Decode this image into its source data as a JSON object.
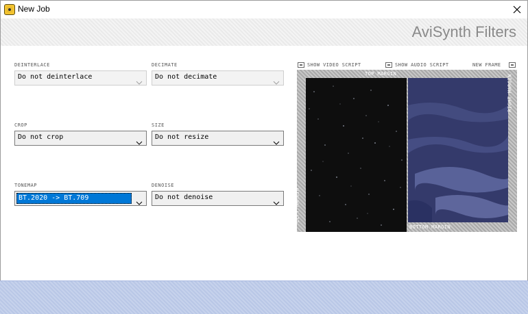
{
  "window": {
    "title": "New Job"
  },
  "header": {
    "title": "AviSynth Filters"
  },
  "filters": {
    "deinterlace": {
      "label": "DEINTERLACE",
      "value": "Do not deinterlace"
    },
    "decimate": {
      "label": "DECIMATE",
      "value": "Do not decimate"
    },
    "crop": {
      "label": "CROP",
      "value": "Do not crop"
    },
    "size": {
      "label": "SIZE",
      "value": "Do not resize"
    },
    "tonemap": {
      "label": "TONEMAP",
      "value": "BT.2020 -> BT.709"
    },
    "denoise": {
      "label": "DENOISE",
      "value": "Do not denoise"
    }
  },
  "preview": {
    "show_video_script": "SHOW VIDEO SCRIPT",
    "show_audio_script": "SHOW AUDIO SCRIPT",
    "new_frame": "NEW FRAME",
    "top_margin": "TOP MARGIN",
    "left_margin": "LEFT MARGIN",
    "right_margin": "RIGHT MARGIN",
    "bottom_margin": "BOTTOM MARGIN"
  },
  "colors": {
    "selection": "#0078d7",
    "header_text": "#8a8a8a",
    "footer_band": "#c6d2ec",
    "video_right": "#2f3564"
  },
  "icons": {
    "app": "app-icon",
    "close": "close-icon",
    "dropdown": "chevron-down-icon",
    "script": "script-icon"
  }
}
